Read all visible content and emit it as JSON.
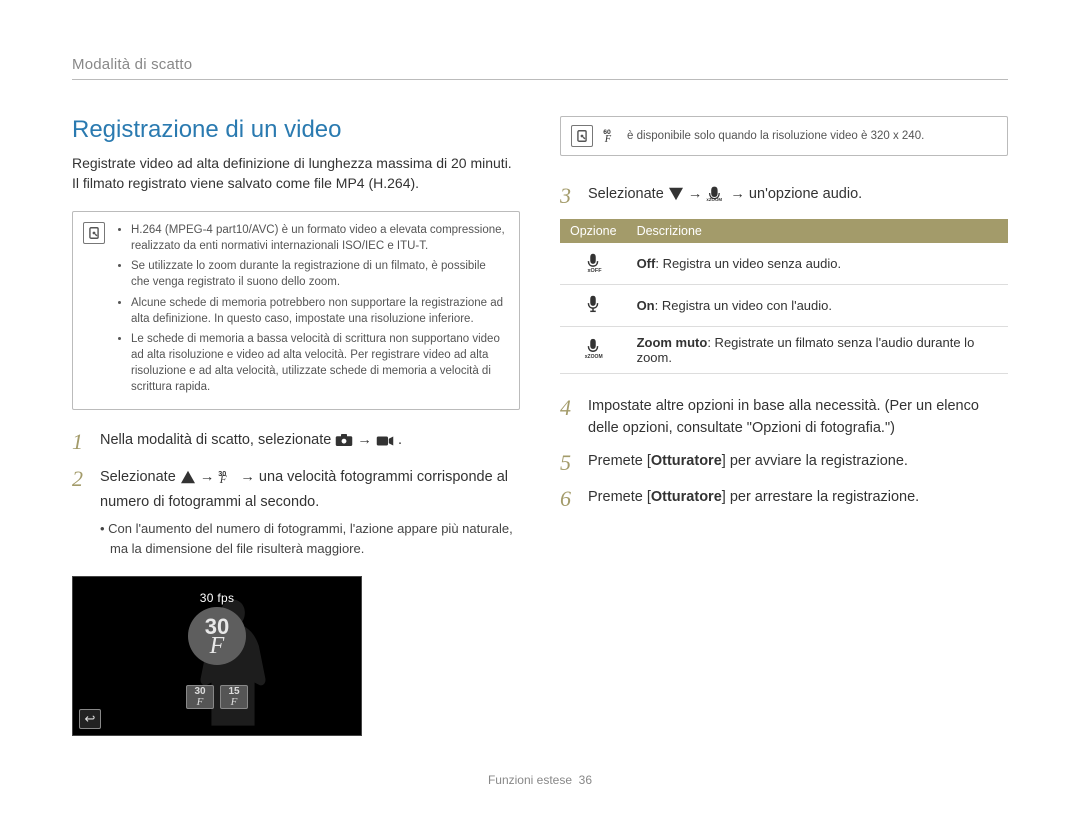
{
  "header": "Modalità di scatto",
  "title": "Registrazione di un video",
  "intro": "Registrate video ad alta definizione di lunghezza massima di 20 minuti. Il filmato registrato viene salvato come file MP4 (H.264).",
  "notes_left": [
    "H.264 (MPEG-4 part10/AVC) è un formato video a elevata compressione, realizzato da enti normativi internazionali ISO/IEC e ITU-T.",
    "Se utilizzate lo zoom durante la registrazione di un filmato, è possibile che venga registrato il suono dello zoom.",
    "Alcune schede di memoria potrebbero non supportare la registrazione ad alta definizione. In questo caso, impostate una risoluzione inferiore.",
    "Le schede di memoria a bassa velocità di scrittura non supportano video ad alta risoluzione e video ad alta velocità. Per registrare video ad alta risoluzione e ad alta velocità, utilizzate schede di memoria a velocità di scrittura rapida."
  ],
  "steps_left": {
    "1": {
      "num": "1",
      "text_a": "Nella modalità di scatto, selezionate ",
      "text_b": " → ",
      "text_c": "."
    },
    "2": {
      "num": "2",
      "text_a": "Selezionate ",
      "text_b": " → ",
      "text_c": " → una velocità fotogrammi corrisponde al numero di fotogrammi al secondo.",
      "sub": "• Con l'aumento del numero di fotogrammi, l'azione appare più naturale, ma la dimensione del file risulterà maggiore."
    }
  },
  "preview": {
    "fps_label": "30 fps",
    "big_number": "30",
    "big_unit": "F",
    "chips": [
      {
        "n": "30",
        "f": "F"
      },
      {
        "n": "15",
        "f": "F"
      }
    ],
    "back_glyph": "↩"
  },
  "note_right": " è disponibile solo quando la risoluzione video è 320 x 240.",
  "note_right_icon_label": "60/F",
  "steps_right": {
    "3": {
      "num": "3",
      "text_a": "Selezionate ",
      "text_b": " → ",
      "text_c": " → un'opzione audio."
    },
    "4": {
      "num": "4",
      "text": "Impostate altre opzioni in base alla necessità. (Per un elenco delle opzioni, consultate \"Opzioni di fotografia.\")"
    },
    "5": {
      "num": "5",
      "text_a": "Premete [",
      "bold": "Otturatore",
      "text_b": "] per avviare la registrazione."
    },
    "6": {
      "num": "6",
      "text_a": "Premete [",
      "bold": "Otturatore",
      "text_b": "] per arrestare la registrazione."
    }
  },
  "options_table": {
    "head_option": "Opzione",
    "head_desc": "Descrizione",
    "rows": [
      {
        "label_bold": "Off",
        "label_rest": ": Registra un video senza audio."
      },
      {
        "label_bold": "On",
        "label_rest": ": Registra un video con l'audio."
      },
      {
        "label_bold": "Zoom muto",
        "label_rest": ": Registrate un filmato senza l'audio durante lo zoom."
      }
    ]
  },
  "footer": {
    "label": "Funzioni estese",
    "page": "36"
  }
}
